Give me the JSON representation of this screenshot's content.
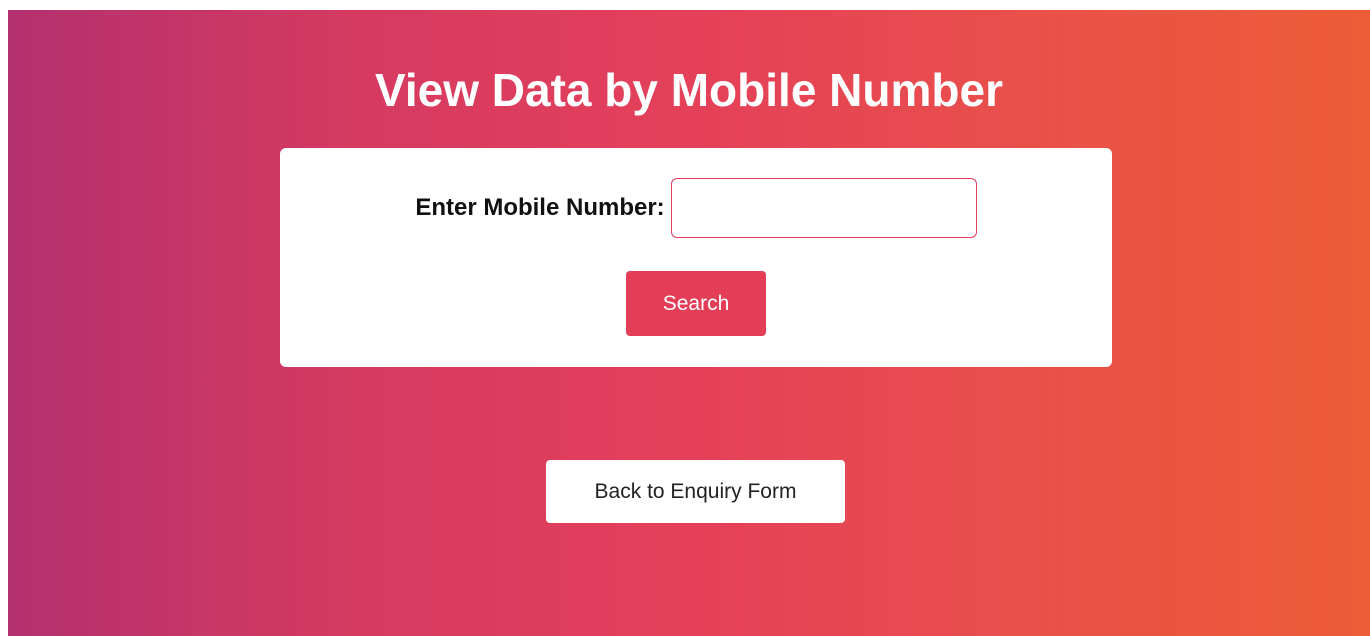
{
  "page": {
    "title": "View Data by Mobile Number"
  },
  "form": {
    "mobile_label": "Enter Mobile Number:",
    "mobile_value": "",
    "mobile_placeholder": "",
    "search_label": "Search"
  },
  "navigation": {
    "back_label": "Back to Enquiry Form"
  },
  "colors": {
    "gradient_start": "#b3306e",
    "gradient_end": "#ec5c36",
    "accent": "#e33d57",
    "card_background": "#ffffff"
  }
}
